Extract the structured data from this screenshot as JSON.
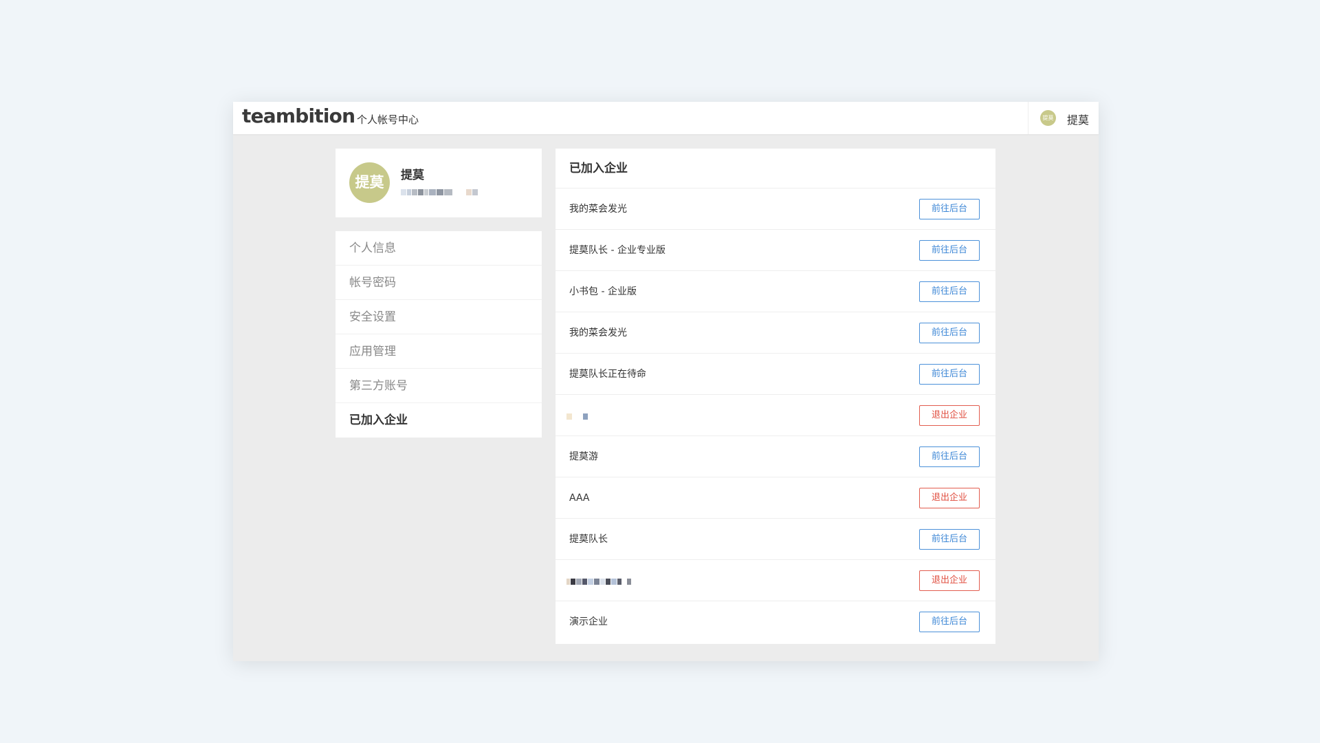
{
  "header": {
    "logo": "teambition",
    "subtitle": "个人帐号中心",
    "avatar_text": "提莫",
    "username": "提莫"
  },
  "profile": {
    "avatar_text": "提莫",
    "name": "提莫"
  },
  "menu": {
    "items": [
      {
        "label": "个人信息"
      },
      {
        "label": "帐号密码"
      },
      {
        "label": "安全设置"
      },
      {
        "label": "应用管理"
      },
      {
        "label": "第三方账号"
      },
      {
        "label": "已加入企业"
      }
    ],
    "active_index": 5
  },
  "panel": {
    "title": "已加入企业",
    "rows": [
      {
        "name": "我的菜会发光",
        "action": "前往后台",
        "type": "go"
      },
      {
        "name": "提莫队长 - 企业专业版",
        "action": "前往后台",
        "type": "go"
      },
      {
        "name": "小书包 - 企业版",
        "action": "前往后台",
        "type": "go"
      },
      {
        "name": "我的菜会发光",
        "action": "前往后台",
        "type": "go"
      },
      {
        "name": "提莫队长正在待命",
        "action": "前往后台",
        "type": "go"
      },
      {
        "name": "",
        "action": "退出企业",
        "type": "quit",
        "redacted": true
      },
      {
        "name": "提莫游",
        "action": "前往后台",
        "type": "go"
      },
      {
        "name": "AAA",
        "action": "退出企业",
        "type": "quit"
      },
      {
        "name": "提莫队长",
        "action": "前往后台",
        "type": "go"
      },
      {
        "name": "",
        "action": "退出企业",
        "type": "quit",
        "redacted": true
      },
      {
        "name": "演示企业",
        "action": "前往后台",
        "type": "go"
      }
    ]
  },
  "colors": {
    "page_bg": "#f0f5f9",
    "window_bg": "#ececec",
    "avatar": "#c7c98a",
    "go_button": "#3d87d6",
    "quit_button": "#e04e3f"
  }
}
